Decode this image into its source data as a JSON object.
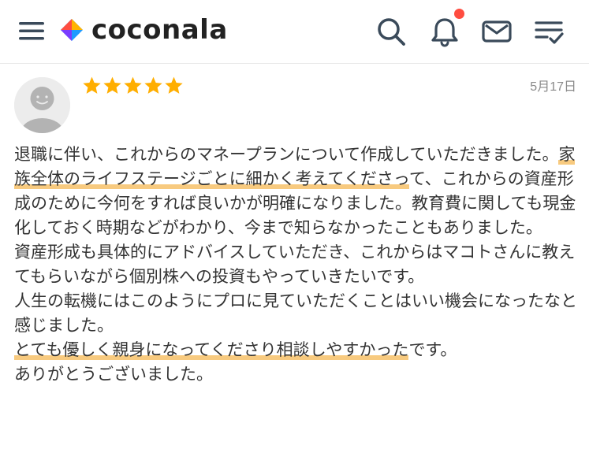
{
  "header": {
    "logo_text": "coconala",
    "icons": [
      "menu-icon",
      "search-icon",
      "bell-icon",
      "mail-icon",
      "todo-list-icon"
    ],
    "notification_dot_color": "#ff4d40",
    "brand_colors": [
      "#ff4d40",
      "#ffb400",
      "#1e9bff",
      "#7a3cff"
    ]
  },
  "review": {
    "rating": 5,
    "star_color": "#ffae00",
    "date": "5月17日",
    "segments": {
      "s1": "退職に伴い、これからのマネープランについて作成していただきました。",
      "h1": "家族全体のライフステージごとに細かく考えてくださっ",
      "s2": "て、これからの資産形成のために今何をすれば良いかが明確になりました。教育費に関しても現金化しておく時期などがわかり、今まで知らなかったこともありました。\n資産形成も具体的にアドバイスしていただき、これからはマコトさんに教えてもらいながら個別株への投資もやっていきたいです。\n人生の転機にはこのようにプロに見ていただくことはいい機会になったなと感じました。\n",
      "h2": "とても優しく親身になってくださり相談しやすかった",
      "s3": "です。\nありがとうございました。"
    },
    "highlight_color": "#f7c778"
  }
}
